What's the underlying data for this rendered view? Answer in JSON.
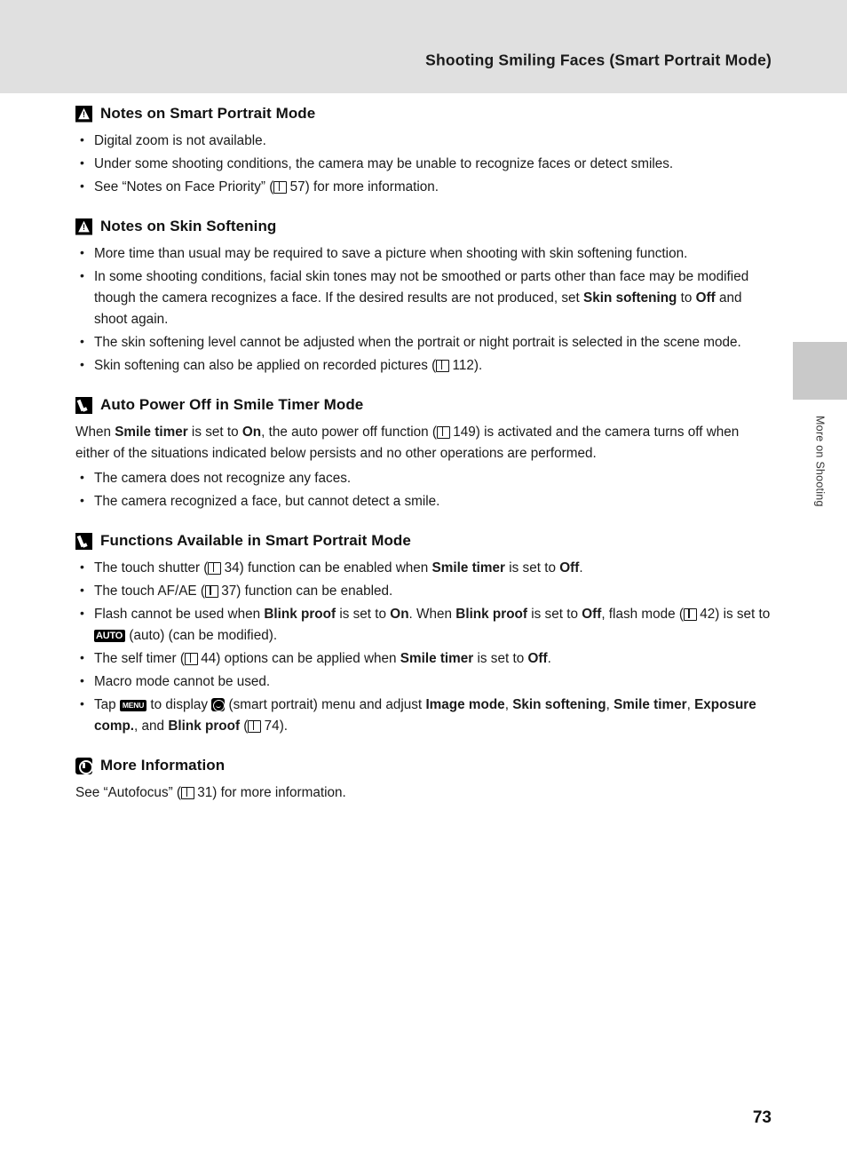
{
  "header": {
    "title": "Shooting Smiling Faces (Smart Portrait Mode)"
  },
  "side_tab": {
    "label": "More on Shooting"
  },
  "page_number": "73",
  "sections": [
    {
      "icon": "warning-icon",
      "title": "Notes on Smart Portrait Mode",
      "bullets": [
        "Digital zoom is not available.",
        "Under some shooting conditions, the camera may be unable to recognize faces or detect smiles.",
        "See “Notes on Face Priority” (A 57) for more information."
      ]
    },
    {
      "icon": "warning-icon",
      "title": "Notes on Skin Softening",
      "bullets": [
        "More time than usual may be required to save a picture when shooting with skin softening function.",
        "In some shooting conditions, facial skin tones may not be smoothed or parts other than face may be modified though the camera recognizes a face. If the desired results are not produced, set Skin softening to Off and shoot again.",
        "The skin softening level cannot be adjusted when the portrait or night portrait is selected in the scene mode.",
        "Skin softening can also be applied on recorded pictures (A 112)."
      ]
    },
    {
      "icon": "pencil-icon",
      "title": "Auto Power Off in Smile Timer Mode",
      "paragraph": "When Smile timer is set to On, the auto power off function (A 149) is activated and the camera turns off when either of the situations indicated below persists and no other operations are performed.",
      "bullets": [
        "The camera does not recognize any faces.",
        "The camera recognized a face, but cannot detect a smile."
      ]
    },
    {
      "icon": "pencil-icon",
      "title": "Functions Available in Smart Portrait Mode",
      "bullets": [
        "The touch shutter (A 34) function can be enabled when Smile timer is set to Off.",
        "The touch AF/AE (A 37) function can be enabled.",
        "Flash cannot be used when Blink proof is set to On. When Blink proof is set to Off, flash mode (A 42) is set to AUTO (auto) (can be modified).",
        "The self timer (A 44) options can be applied when Smile timer is set to Off.",
        "Macro mode cannot be used.",
        "Tap MENU to display (smart portrait) menu and adjust Image mode, Skin softening, Smile timer, Exposure comp., and Blink proof (A 74)."
      ]
    },
    {
      "icon": "info-icon",
      "title": "More Information",
      "paragraph": "See “Autofocus” (A 31) for more information."
    }
  ],
  "inline": {
    "ref_57": "57",
    "ref_112": "112",
    "ref_149": "149",
    "ref_34": "34",
    "ref_37": "37",
    "ref_42": "42",
    "ref_44": "44",
    "ref_74": "74",
    "ref_31": "31",
    "flash_auto_label": "AUTO",
    "menu_label": "MENU"
  }
}
